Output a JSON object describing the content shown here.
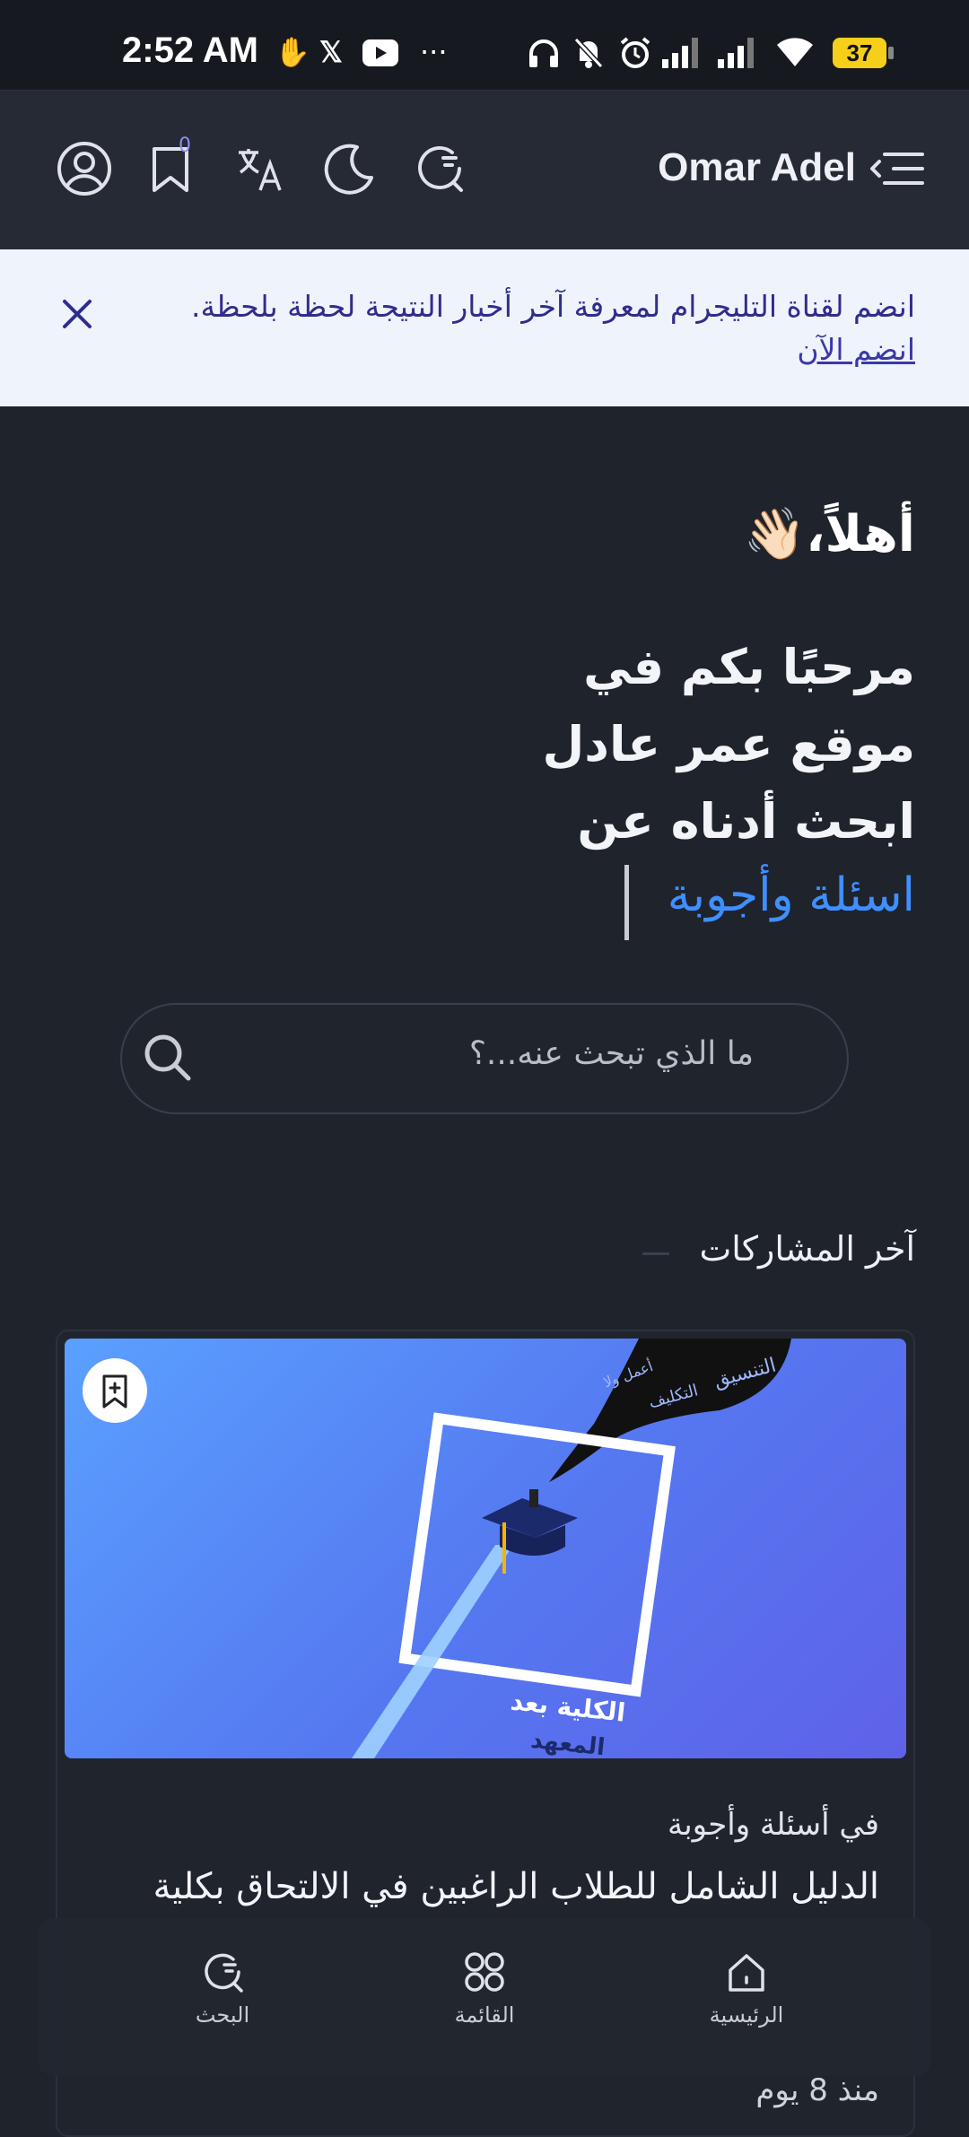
{
  "status_bar": {
    "time": "2:52 AM",
    "battery": "37",
    "more": "···"
  },
  "header": {
    "title": "Omar Adel",
    "bookmark_count": "0",
    "icons": [
      "menu-icon",
      "search-refresh-icon",
      "moon-icon",
      "translate-icon",
      "bookmark-icon",
      "account-icon"
    ]
  },
  "banner": {
    "text": "انضم لقناة التليجرام لمعرفة آخر أخبار النتيجة لحظة بلحظة.",
    "link": "انضم الآن"
  },
  "hero": {
    "greeting": "أهلاً،",
    "emoji": "👋🏻",
    "line1": "مرحبًا بكم في",
    "line2": "موقع عمر عادل",
    "line3": "ابحث أدناه عن",
    "accent": "اسئلة وأجوبة"
  },
  "search": {
    "placeholder": "ما الذي تبحث عنه...؟"
  },
  "latest": {
    "title": "آخر المشاركات",
    "card": {
      "category": "في أسئلة وأجوبة",
      "title": "الدليل الشامل للطلاب الراغبين في الالتحاق بكلية",
      "date": "منذ 8 يوم",
      "image_text_1": "الكلية بعد",
      "image_text_2": "المعهد",
      "bubble_text_1": "التنسيق",
      "bubble_text_2": "التكليف",
      "bubble_text_3": "أعمل ولا"
    }
  },
  "bottom_nav": {
    "home": "الرئيسية",
    "menu": "القائمة",
    "search": "البحث"
  }
}
